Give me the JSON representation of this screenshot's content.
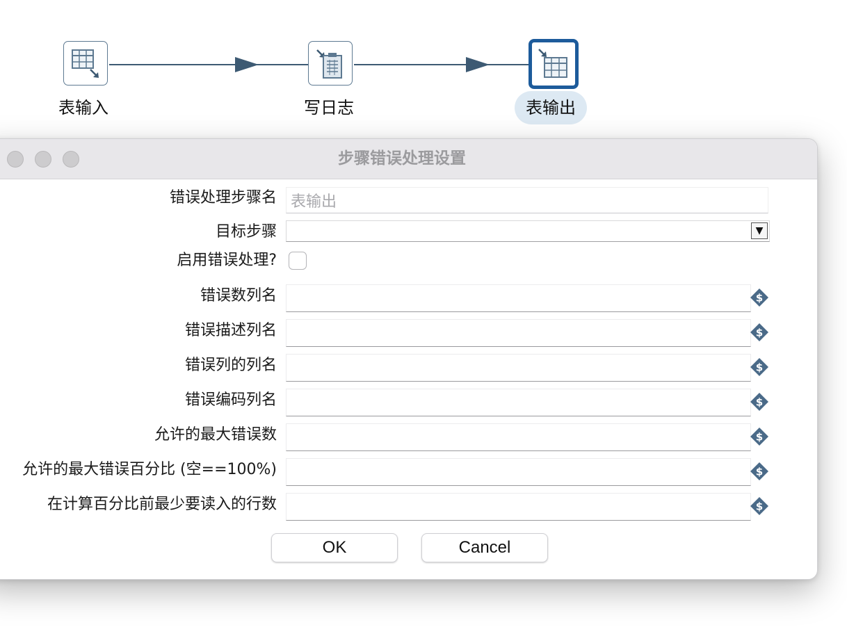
{
  "flow": {
    "steps": [
      {
        "label": "表输入"
      },
      {
        "label": "写日志"
      },
      {
        "label": "表输出",
        "selected": true
      }
    ]
  },
  "dialog": {
    "title": "步骤错误处理设置",
    "fields": {
      "error_step_name": {
        "label": "错误处理步骤名",
        "value": "表输出"
      },
      "target_step": {
        "label": "目标步骤",
        "value": "",
        "dropdown_glyph": "▼"
      },
      "enable_error_handling": {
        "label": "启用错误处理?",
        "checked": false
      },
      "error_count_field": {
        "label": "错误数列名",
        "value": ""
      },
      "error_desc_field": {
        "label": "错误描述列名",
        "value": ""
      },
      "error_fields_field": {
        "label": "错误列的列名",
        "value": ""
      },
      "error_code_field": {
        "label": "错误编码列名",
        "value": ""
      },
      "max_errors": {
        "label": "允许的最大错误数",
        "value": ""
      },
      "max_error_percent": {
        "label": "允许的最大错误百分比 (空==100%)",
        "value": ""
      },
      "min_rows_for_percent": {
        "label": "在计算百分比前最少要读入的行数",
        "value": ""
      }
    },
    "buttons": {
      "ok": "OK",
      "cancel": "Cancel"
    }
  },
  "icons": {
    "variable": "variable-dollar-icon",
    "table_input": "table-input-icon",
    "write_log": "write-log-icon",
    "table_output": "table-output-icon"
  },
  "colors": {
    "hop": "#3d5a73",
    "selected_border": "#1d5b9b",
    "selected_label_bg": "#dde9f3",
    "variable_icon": "#4a6a88"
  }
}
